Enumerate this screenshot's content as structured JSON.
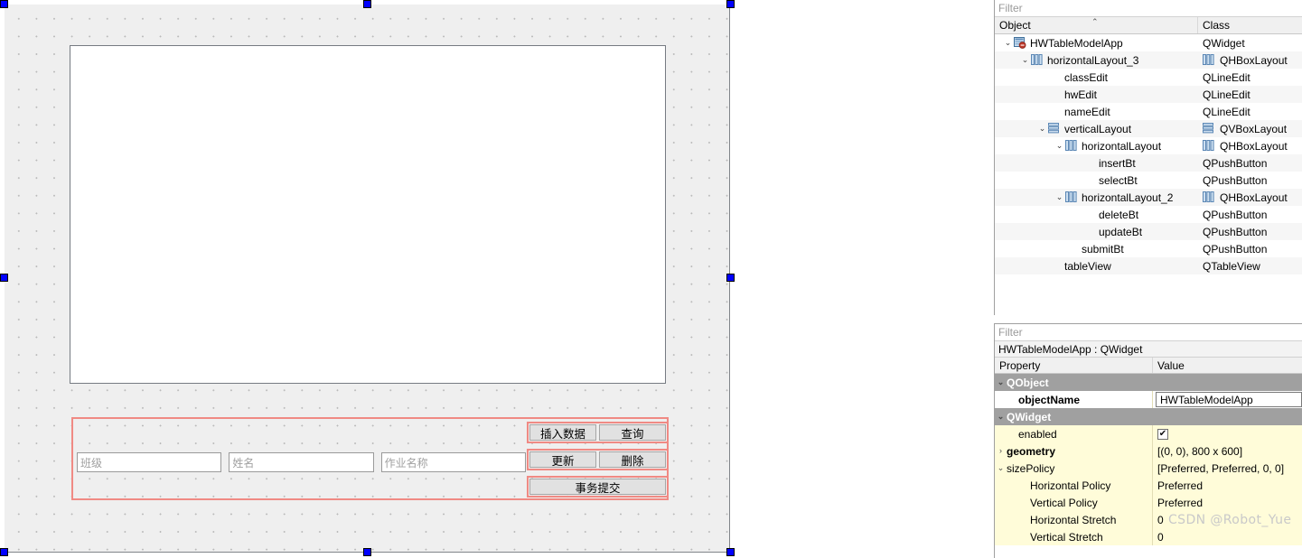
{
  "designer": {
    "form": {
      "widget_name": "HWTableModelApp",
      "table_view_name": "tableView",
      "fields": [
        {
          "name": "classEdit",
          "placeholder": "班级"
        },
        {
          "name": "nameEdit",
          "placeholder": "姓名"
        },
        {
          "name": "hwEdit",
          "placeholder": "作业名称"
        }
      ],
      "button_rows": [
        {
          "row": "horizontalLayout",
          "buttons": [
            {
              "name": "insertBt",
              "label": "插入数据"
            },
            {
              "name": "selectBt",
              "label": "查询"
            }
          ]
        },
        {
          "row": "horizontalLayout_2",
          "buttons": [
            {
              "name": "updateBt",
              "label": "更新"
            },
            {
              "name": "deleteBt",
              "label": "删除"
            }
          ]
        },
        {
          "row": "submit",
          "buttons": [
            {
              "name": "submitBt",
              "label": "事务提交"
            }
          ]
        }
      ]
    },
    "selection_handle_color": "#0000ff",
    "layout_outline_color": "#f08a84"
  },
  "object_inspector": {
    "filter_placeholder": "Filter",
    "columns": {
      "object": "Object",
      "class": "Class"
    },
    "sort_indicator": "⌃",
    "rows": [
      {
        "label": "HWTableModelApp",
        "class": "QWidget",
        "indent": 0,
        "twisty": "v",
        "icon": "widget-icon",
        "class_icon": "none"
      },
      {
        "label": "horizontalLayout_3",
        "class": "QHBoxLayout",
        "indent": 1,
        "twisty": "v",
        "icon": "hbox-icon",
        "class_icon": "hbox-icon"
      },
      {
        "label": "classEdit",
        "class": "QLineEdit",
        "indent": 2,
        "twisty": "",
        "icon": "none",
        "class_icon": "none"
      },
      {
        "label": "hwEdit",
        "class": "QLineEdit",
        "indent": 2,
        "twisty": "",
        "icon": "none",
        "class_icon": "none"
      },
      {
        "label": "nameEdit",
        "class": "QLineEdit",
        "indent": 2,
        "twisty": "",
        "icon": "none",
        "class_icon": "none"
      },
      {
        "label": "verticalLayout",
        "class": "QVBoxLayout",
        "indent": 2,
        "twisty": "v",
        "icon": "vbox-icon",
        "class_icon": "vbox-icon"
      },
      {
        "label": "horizontalLayout",
        "class": "QHBoxLayout",
        "indent": 3,
        "twisty": "v",
        "icon": "hbox-icon",
        "class_icon": "hbox-icon"
      },
      {
        "label": "insertBt",
        "class": "QPushButton",
        "indent": 4,
        "twisty": "",
        "icon": "none",
        "class_icon": "none"
      },
      {
        "label": "selectBt",
        "class": "QPushButton",
        "indent": 4,
        "twisty": "",
        "icon": "none",
        "class_icon": "none"
      },
      {
        "label": "horizontalLayout_2",
        "class": "QHBoxLayout",
        "indent": 3,
        "twisty": "v",
        "icon": "hbox-icon",
        "class_icon": "hbox-icon"
      },
      {
        "label": "deleteBt",
        "class": "QPushButton",
        "indent": 4,
        "twisty": "",
        "icon": "none",
        "class_icon": "none"
      },
      {
        "label": "updateBt",
        "class": "QPushButton",
        "indent": 4,
        "twisty": "",
        "icon": "none",
        "class_icon": "none"
      },
      {
        "label": "submitBt",
        "class": "QPushButton",
        "indent": 3,
        "twisty": "",
        "icon": "none",
        "class_icon": "none"
      },
      {
        "label": "tableView",
        "class": "QTableView",
        "indent": 2,
        "twisty": "",
        "icon": "none",
        "class_icon": "none"
      }
    ]
  },
  "property_editor": {
    "filter_placeholder": "Filter",
    "object_line": "HWTableModelApp : QWidget",
    "columns": {
      "property": "Property",
      "value": "Value"
    },
    "rows": [
      {
        "name": "QObject",
        "value": "",
        "kind": "group",
        "indent": 0,
        "chevron": "v"
      },
      {
        "name": "objectName",
        "value": "HWTableModelApp",
        "kind": "objname",
        "indent": 1,
        "chevron": ""
      },
      {
        "name": "QWidget",
        "value": "",
        "kind": "group",
        "indent": 0,
        "chevron": "v"
      },
      {
        "name": "enabled",
        "value": "checked",
        "kind": "check",
        "indent": 1,
        "chevron": ""
      },
      {
        "name": "geometry",
        "value": "[(0, 0), 800 x 600]",
        "kind": "bold",
        "indent": 0,
        "chevron": ">"
      },
      {
        "name": "sizePolicy",
        "value": "[Preferred, Preferred, 0, 0]",
        "kind": "plain",
        "indent": 0,
        "chevron": "v"
      },
      {
        "name": "Horizontal Policy",
        "value": "Preferred",
        "kind": "plain",
        "indent": 2,
        "chevron": ""
      },
      {
        "name": "Vertical Policy",
        "value": "Preferred",
        "kind": "plain",
        "indent": 2,
        "chevron": ""
      },
      {
        "name": "Horizontal Stretch",
        "value": "0",
        "kind": "plain",
        "indent": 2,
        "chevron": ""
      },
      {
        "name": "Vertical Stretch",
        "value": "0",
        "kind": "plain",
        "indent": 2,
        "chevron": ""
      }
    ]
  },
  "watermark": "CSDN @Robot_Yue"
}
